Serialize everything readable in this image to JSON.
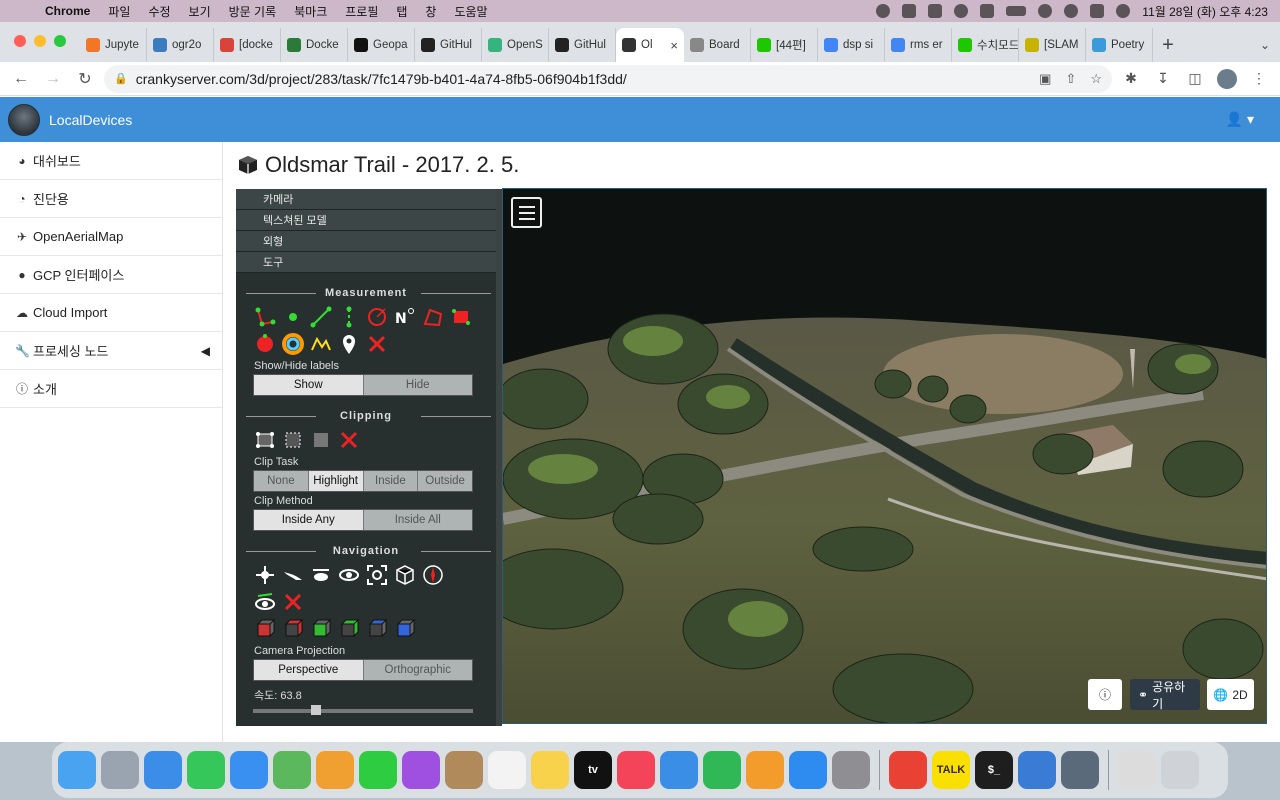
{
  "menubar": {
    "app_name": "Chrome",
    "items": [
      "파일",
      "수정",
      "보기",
      "방문 기록",
      "북마크",
      "프로필",
      "탭",
      "창",
      "도움말"
    ],
    "clock": "11월 28일 (화) 오후 4:23"
  },
  "browser": {
    "tabs": [
      {
        "label": "Jupyte",
        "color": "#f37626"
      },
      {
        "label": "ogr2o",
        "color": "#3b7bbf"
      },
      {
        "label": "[docke",
        "color": "#d9443a"
      },
      {
        "label": "Docke",
        "color": "#2c7a3a"
      },
      {
        "label": "Geopa",
        "color": "#111111"
      },
      {
        "label": "GitHul",
        "color": "#222222"
      },
      {
        "label": "OpenS",
        "color": "#36b37e"
      },
      {
        "label": "GitHul",
        "color": "#222222"
      },
      {
        "label": "Ol",
        "color": "#333333",
        "active": true
      },
      {
        "label": "Board",
        "color": "#888888"
      },
      {
        "label": "[44편]",
        "color": "#1ec800"
      },
      {
        "label": "dsp si",
        "color": "#4285f4"
      },
      {
        "label": "rms er",
        "color": "#4285f4"
      },
      {
        "label": "수치모드",
        "color": "#1ec800"
      },
      {
        "label": "[SLAM",
        "color": "#c8b400"
      },
      {
        "label": "Poetry",
        "color": "#3b9bd9"
      }
    ],
    "url": "crankyserver.com/3d/project/283/task/7fc1479b-b401-4a74-8fb5-06f904b1f3dd/"
  },
  "app": {
    "brand": "LocalDevices",
    "header_color": "#3e8ed8"
  },
  "sidebar": {
    "items": [
      {
        "label": "대쉬보드",
        "icon": "dashboard-icon"
      },
      {
        "label": "진단용",
        "icon": "pie-chart-icon"
      },
      {
        "label": "OpenAerialMap",
        "icon": "plane-icon"
      },
      {
        "label": "GCP 인터페이스",
        "icon": "map-marker-icon"
      },
      {
        "label": "Cloud Import",
        "icon": "cloud-download-icon"
      },
      {
        "label": "프로세싱 노드",
        "icon": "wrench-icon"
      },
      {
        "label": "소개",
        "icon": "info-icon"
      }
    ]
  },
  "page": {
    "title": "Oldsmar Trail - 2017. 2. 5."
  },
  "potree": {
    "accordion": [
      "카메라",
      "텍스쳐된 모델",
      "외형",
      "도구"
    ],
    "measurement_title": "Measurement",
    "show_hide_label": "Show/Hide labels",
    "show": "Show",
    "hide": "Hide",
    "clipping_title": "Clipping",
    "clip_task_label": "Clip Task",
    "clip_task_options": [
      "None",
      "Highlight",
      "Inside",
      "Outside"
    ],
    "clip_task_selected": "Highlight",
    "clip_method_label": "Clip Method",
    "clip_method_options": [
      "Inside Any",
      "Inside All"
    ],
    "clip_method_selected": "Inside Any",
    "navigation_title": "Navigation",
    "camera_projection_label": "Camera Projection",
    "projection_options": [
      "Perspective",
      "Orthographic"
    ],
    "projection_selected": "Perspective",
    "speed_label": "속도: 63.8"
  },
  "viewport": {
    "share_label": "공유하기",
    "view_2d_label": "2D"
  },
  "dock": {
    "apps": [
      {
        "name": "finder-icon",
        "color": "#4aa3f0"
      },
      {
        "name": "launchpad-icon",
        "color": "#9aa4b0"
      },
      {
        "name": "safari-icon",
        "color": "#3c8de8"
      },
      {
        "name": "messages-icon",
        "color": "#35c759"
      },
      {
        "name": "mail-icon",
        "color": "#3a90f0"
      },
      {
        "name": "maps-icon",
        "color": "#5cb85c"
      },
      {
        "name": "photos-icon",
        "color": "#f0a030"
      },
      {
        "name": "facetime-icon",
        "color": "#2ecc40"
      },
      {
        "name": "podcasts-icon",
        "color": "#a050e0"
      },
      {
        "name": "contacts-icon",
        "color": "#b08a5a"
      },
      {
        "name": "reminders-icon",
        "color": "#f3f3f3"
      },
      {
        "name": "notes-icon",
        "color": "#f7d24a"
      },
      {
        "name": "tv-icon",
        "color": "#111111",
        "text": "tv"
      },
      {
        "name": "music-icon",
        "color": "#f4445a"
      },
      {
        "name": "keynote-icon",
        "color": "#3a8ee6"
      },
      {
        "name": "numbers-icon",
        "color": "#2fb855"
      },
      {
        "name": "pages-icon",
        "color": "#f39c2b"
      },
      {
        "name": "app-store-icon",
        "color": "#2e8cf0"
      },
      {
        "name": "system-settings-icon",
        "color": "#8e8e93"
      },
      {
        "name": "chrome-icon",
        "color": "#e94235"
      },
      {
        "name": "kakaotalk-icon",
        "color": "#f9e000",
        "text": "TALK"
      },
      {
        "name": "terminal-icon",
        "color": "#1e1e1e",
        "text": "$_"
      },
      {
        "name": "xcode-icon",
        "color": "#3a7bd5"
      },
      {
        "name": "qgis-icon",
        "color": "#5a6a7a"
      },
      {
        "name": "archive-icon",
        "color": "#dcdcdc"
      },
      {
        "name": "trash-icon",
        "color": "#cfd3d8"
      }
    ]
  }
}
